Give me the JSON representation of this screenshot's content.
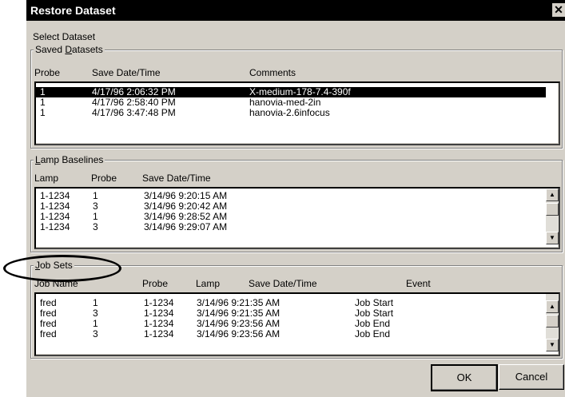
{
  "dialog": {
    "title": "Restore Dataset",
    "close_glyph": "✕",
    "select_label": "Select Dataset"
  },
  "saved": {
    "legend_pre": "Saved ",
    "legend_u": "D",
    "legend_post": "atasets",
    "headers": [
      "Probe",
      "Save Date/Time",
      "Comments"
    ],
    "rows": [
      {
        "probe": "1",
        "date": "4/17/96 2:06:32 PM",
        "comment": "X-medium-178-7.4-390f",
        "selected": true
      },
      {
        "probe": "1",
        "date": "4/17/96 2:58:40 PM",
        "comment": "hanovia-med-2in",
        "selected": false
      },
      {
        "probe": "1",
        "date": "4/17/96 3:47:48 PM",
        "comment": "hanovia-2.6infocus",
        "selected": false
      }
    ]
  },
  "lamp": {
    "legend_u": "L",
    "legend_post": "amp Baselines",
    "headers": [
      "Lamp",
      "Probe",
      "Save Date/Time"
    ],
    "rows": [
      {
        "lamp": "1-1234",
        "probe": "1",
        "date": "3/14/96 9:20:15 AM"
      },
      {
        "lamp": "1-1234",
        "probe": "3",
        "date": "3/14/96 9:20:42 AM"
      },
      {
        "lamp": "1-1234",
        "probe": "1",
        "date": "3/14/96 9:28:52 AM"
      },
      {
        "lamp": "1-1234",
        "probe": "3",
        "date": "3/14/96 9:29:07 AM"
      }
    ]
  },
  "jobs": {
    "legend_u": "J",
    "legend_post": "ob Sets",
    "headers": [
      "Job Name",
      "Probe",
      "Lamp",
      "Save Date/Time",
      "Event"
    ],
    "rows": [
      {
        "job": "fred",
        "probe": "1",
        "lamp": "1-1234",
        "date": "3/14/96 9:21:35 AM",
        "event": "Job Start"
      },
      {
        "job": "fred",
        "probe": "3",
        "lamp": "1-1234",
        "date": "3/14/96 9:21:35 AM",
        "event": "Job Start"
      },
      {
        "job": "fred",
        "probe": "1",
        "lamp": "1-1234",
        "date": "3/14/96 9:23:56 AM",
        "event": "Job End"
      },
      {
        "job": "fred",
        "probe": "3",
        "lamp": "1-1234",
        "date": "3/14/96 9:23:56 AM",
        "event": "Job End"
      }
    ]
  },
  "buttons": {
    "ok": "OK",
    "cancel": "Cancel"
  },
  "scroll_glyphs": {
    "up": "▲",
    "down": "▼"
  }
}
